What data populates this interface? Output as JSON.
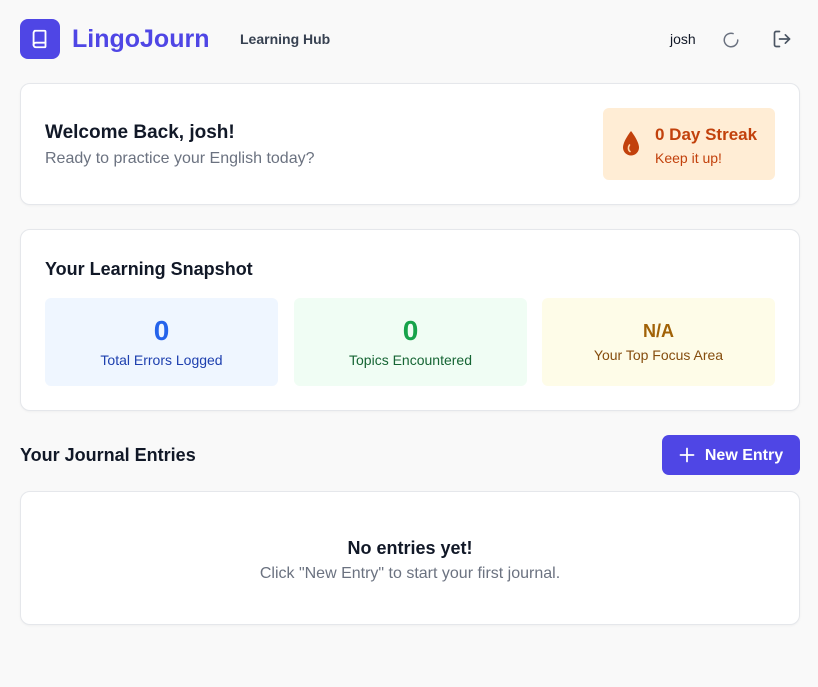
{
  "header": {
    "brand": "LingoJourn",
    "nav_link": "Learning Hub",
    "username": "josh",
    "logo_icon": "book-icon",
    "refresh_icon": "refresh-icon",
    "logout_icon": "logout-icon"
  },
  "welcome": {
    "title": "Welcome Back, josh!",
    "subtitle": "Ready to practice your English today?",
    "streak": {
      "icon": "flame-icon",
      "title": "0 Day Streak",
      "subtitle": "Keep it up!"
    }
  },
  "snapshot": {
    "title": "Your Learning Snapshot",
    "stats": [
      {
        "value": "0",
        "label": "Total Errors Logged"
      },
      {
        "value": "0",
        "label": "Topics Encountered"
      },
      {
        "value": "N/A",
        "label": "Your Top Focus Area"
      }
    ]
  },
  "journal": {
    "title": "Your Journal Entries",
    "new_entry_label": "New Entry",
    "new_entry_icon": "plus-icon",
    "empty_title": "No entries yet!",
    "empty_subtitle": "Click \"New Entry\" to start your first journal."
  },
  "colors": {
    "accent": "#4f46e5",
    "background": "#f9f9f9",
    "streak_bg": "#ffedd5",
    "streak_text": "#c2410c"
  }
}
